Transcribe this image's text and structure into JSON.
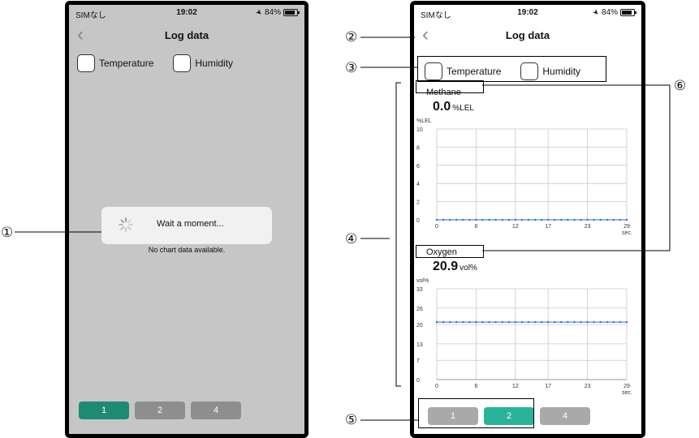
{
  "status": {
    "carrier": "SIMなし",
    "time": "19:02",
    "battery": "84%"
  },
  "nav": {
    "title": "Log data",
    "back_icon": "chevron-left-icon"
  },
  "checks": {
    "temperature": "Temperature",
    "humidity": "Humidity"
  },
  "loading": {
    "message": "Wait a moment...",
    "empty": "No chart data available."
  },
  "pager_left": {
    "buttons": [
      "1",
      "2",
      "4"
    ],
    "active": "1"
  },
  "pager_right": {
    "buttons": [
      "1",
      "2",
      "4"
    ],
    "active": "2"
  },
  "callouts": [
    "①",
    "②",
    "③",
    "④",
    "⑤",
    "⑥"
  ],
  "colors": {
    "accent_dark": "#1e8a73",
    "accent": "#2ab397",
    "series": "#2f6fd6",
    "grid": "#cccccc"
  },
  "chart_data": [
    {
      "type": "line",
      "title": "Methane",
      "reading": "0.0",
      "reading_unit": "%LEL",
      "ylabel": "%LEL",
      "xlabel": "sec.",
      "ylim": [
        0,
        10
      ],
      "yticks": [
        "0",
        "2",
        "4",
        "6",
        "8",
        "10"
      ],
      "xticks": [
        "0",
        "6",
        "12",
        "17",
        "23",
        "29"
      ],
      "x": [
        0,
        1,
        2,
        3,
        4,
        5,
        6,
        7,
        8,
        9,
        10,
        11,
        12,
        13,
        14,
        15,
        16,
        17,
        18,
        19,
        20,
        21,
        22,
        23,
        24,
        25,
        26,
        27,
        28,
        29
      ],
      "values": [
        0,
        0,
        0,
        0,
        0,
        0,
        0,
        0,
        0,
        0,
        0,
        0,
        0,
        0,
        0,
        0,
        0,
        0,
        0,
        0,
        0,
        0,
        0,
        0,
        0,
        0,
        0,
        0,
        0,
        0
      ],
      "grid": true
    },
    {
      "type": "line",
      "title": "Oxygen",
      "reading": "20.9",
      "reading_unit": "vol%",
      "ylabel": "vol%",
      "xlabel": "sec.",
      "ylim": [
        0,
        33
      ],
      "yticks": [
        "0",
        "7",
        "13",
        "20",
        "26",
        "33"
      ],
      "xticks": [
        "0",
        "6",
        "12",
        "17",
        "23",
        "29"
      ],
      "x": [
        0,
        1,
        2,
        3,
        4,
        5,
        6,
        7,
        8,
        9,
        10,
        11,
        12,
        13,
        14,
        15,
        16,
        17,
        18,
        19,
        20,
        21,
        22,
        23,
        24,
        25,
        26,
        27,
        28,
        29
      ],
      "values": [
        20.9,
        20.9,
        20.9,
        20.9,
        20.9,
        20.9,
        20.9,
        20.9,
        20.9,
        20.9,
        20.9,
        20.9,
        20.9,
        20.9,
        20.9,
        20.9,
        20.9,
        20.9,
        20.9,
        20.9,
        20.9,
        20.9,
        20.9,
        20.9,
        20.9,
        20.9,
        20.9,
        20.9,
        20.9,
        20.9
      ],
      "grid": true
    }
  ]
}
